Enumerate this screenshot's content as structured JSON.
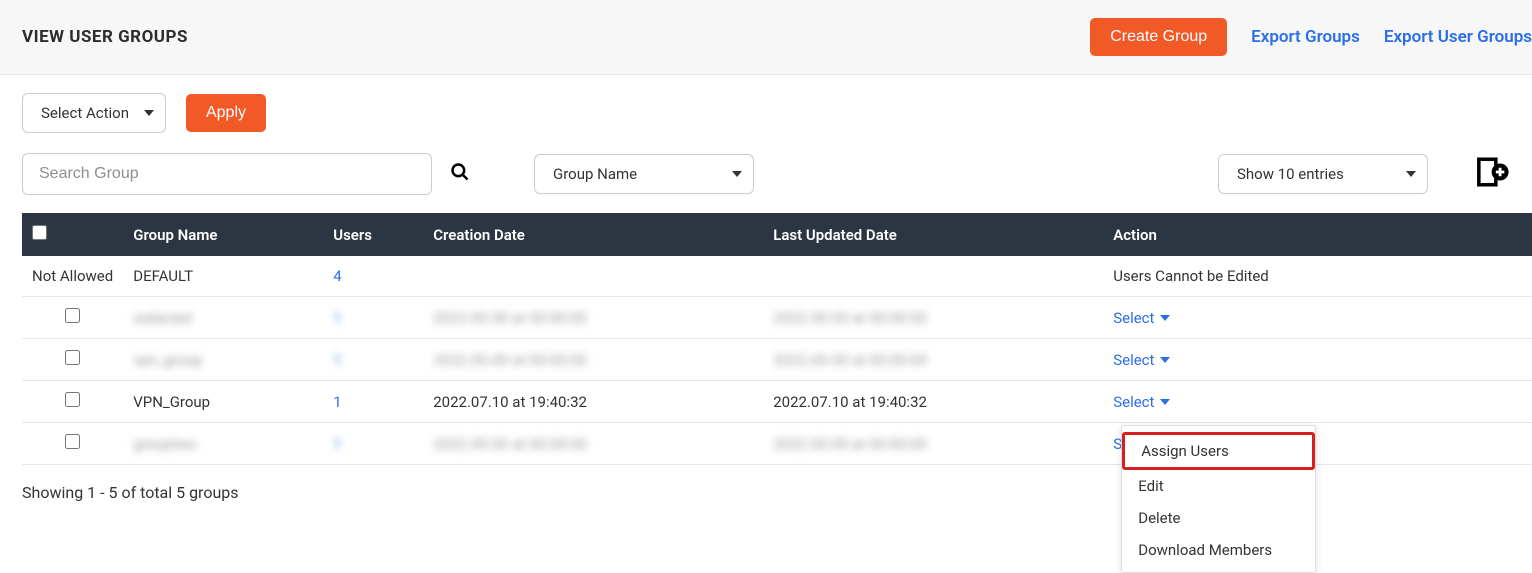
{
  "header": {
    "title": "VIEW USER GROUPS",
    "create_btn": "Create Group",
    "export_groups": "Export Groups",
    "export_user_groups": "Export User Groups"
  },
  "toolbar": {
    "select_action": "Select Action",
    "apply": "Apply"
  },
  "filters": {
    "search_placeholder": "Search Group",
    "group_name_filter": "Group Name",
    "entries": "Show 10 entries"
  },
  "table": {
    "columns": {
      "group_name": "Group Name",
      "users": "Users",
      "creation_date": "Creation Date",
      "last_updated": "Last Updated Date",
      "action": "Action"
    },
    "rows": [
      {
        "check_label": "Not Allowed",
        "group_name": "DEFAULT",
        "users": "4",
        "creation_date": "",
        "last_updated": "",
        "action_text": "Users Cannot be Edited",
        "action_type": "text",
        "blurred": false,
        "check_visible": false
      },
      {
        "group_name": "redacted",
        "users": "1",
        "creation_date": "2022.00.00 at 00:00:00",
        "last_updated": "2022.00.00 at 00:00:00",
        "action_text": "Select",
        "action_type": "select",
        "blurred": true,
        "check_visible": true
      },
      {
        "group_name": "vpn_group",
        "users": "1",
        "creation_date": "2022.00.00 at 00:00:00",
        "last_updated": "2022.00.00 at 00:00:00",
        "action_text": "Select",
        "action_type": "select",
        "blurred": true,
        "check_visible": true
      },
      {
        "group_name": "VPN_Group",
        "users": "1",
        "creation_date": "2022.07.10 at 19:40:32",
        "last_updated": "2022.07.10 at 19:40:32",
        "action_text": "Select",
        "action_type": "select",
        "blurred": false,
        "check_visible": true,
        "menu_open": true
      },
      {
        "group_name": "grouptwo",
        "users": "1",
        "creation_date": "2022.00.00 at 00:00:00",
        "last_updated": "2022.00.00 at 00:00:00",
        "action_text": "Select",
        "action_type": "select",
        "blurred": true,
        "check_visible": true
      }
    ]
  },
  "dropdown": {
    "items": [
      "Assign Users",
      "Edit",
      "Delete",
      "Download Members"
    ],
    "highlighted_index": 0
  },
  "status": "Showing 1 - 5 of total 5 groups"
}
